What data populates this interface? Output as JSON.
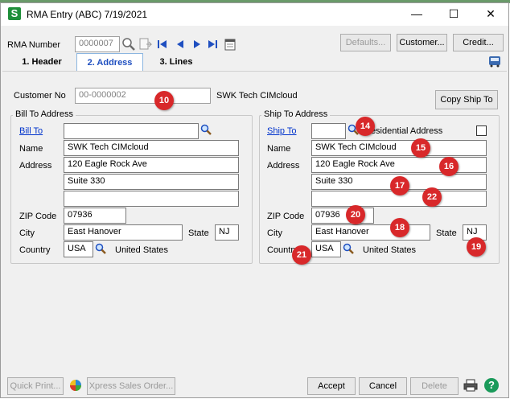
{
  "window": {
    "title": "RMA Entry (ABC) 7/19/2021",
    "app_icon_letter": "S",
    "minimize_symbol": "—",
    "maximize_symbol": "☐",
    "close_symbol": "✕"
  },
  "header": {
    "rma_number_label": "RMA Number",
    "rma_number_value": "0000007",
    "defaults_label": "Defaults...",
    "customer_label": "Customer...",
    "credit_label": "Credit..."
  },
  "tabs": [
    {
      "label": "1. Header"
    },
    {
      "label": "2. Address"
    },
    {
      "label": "3. Lines"
    }
  ],
  "customer": {
    "label": "Customer No",
    "value": "00-0000002",
    "name": "SWK Tech CIMcloud",
    "copy_ship_to_label": "Copy Ship To"
  },
  "bill_to": {
    "group_label": "Bill To Address",
    "bill_to_link": "Bill To",
    "bill_to_code": "",
    "name_label": "Name",
    "name": "SWK Tech CIMcloud",
    "address_label": "Address",
    "address1": "120 Eagle Rock Ave",
    "address2": "Suite 330",
    "address3": "",
    "zip_label": "ZIP Code",
    "zip": "07936",
    "city_label": "City",
    "city": "East Hanover",
    "state_label": "State",
    "state": "NJ",
    "country_label": "Country",
    "country": "USA",
    "country_name": "United States"
  },
  "ship_to": {
    "group_label": "Ship To Address",
    "ship_to_link": "Ship To",
    "ship_to_code": "",
    "residential_label": "Residential Address",
    "residential_checked": false,
    "name_label": "Name",
    "name": "SWK Tech CIMcloud",
    "address_label": "Address",
    "address1": "120 Eagle Rock Ave",
    "address2": "Suite 330",
    "address3": "",
    "zip_label": "ZIP Code",
    "zip": "07936",
    "city_label": "City",
    "city": "East Hanover",
    "state_label": "State",
    "state": "NJ",
    "country_label": "Country",
    "country": "USA",
    "country_name": "United States"
  },
  "badges": {
    "b10": "10",
    "b14": "14",
    "b15": "15",
    "b16": "16",
    "b17": "17",
    "b18": "18",
    "b19": "19",
    "b20": "20",
    "b21": "21",
    "b22": "22"
  },
  "footer": {
    "quick_print_label": "Quick Print...",
    "xpress_sales_order_label": "Xpress Sales Order...",
    "accept_label": "Accept",
    "cancel_label": "Cancel",
    "delete_label": "Delete",
    "help_symbol": "?"
  },
  "colors": {
    "badge": "#d8282a",
    "app_icon": "#1f8f3a",
    "link": "#0033cc",
    "help": "#1a9a5a"
  }
}
